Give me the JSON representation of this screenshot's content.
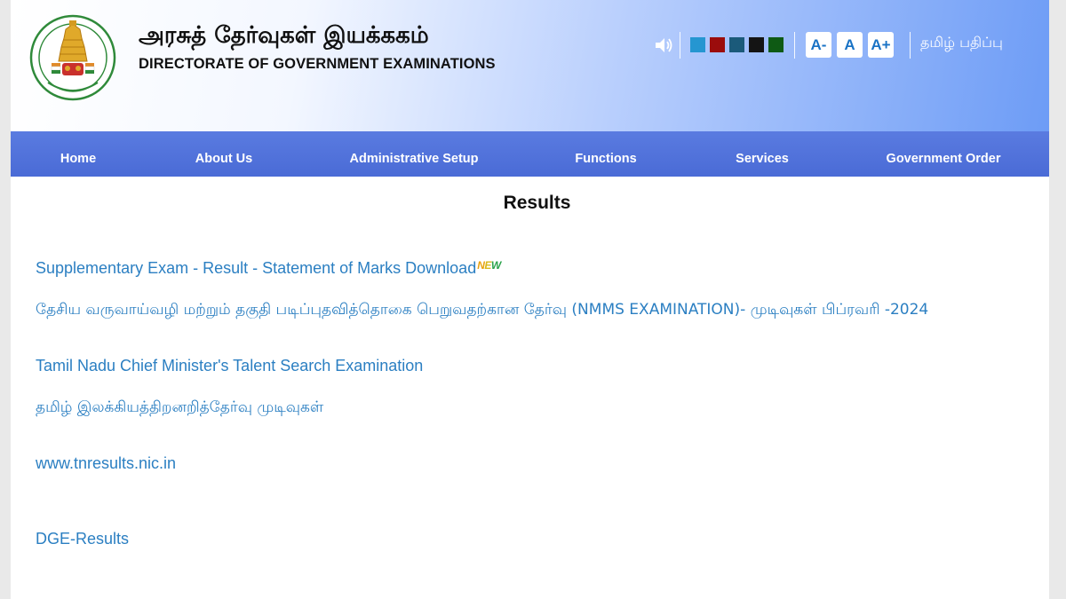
{
  "header": {
    "title_tamil": "அரசுத் தேர்வுகள் இயக்ககம்",
    "title_english": "DIRECTORATE OF GOVERNMENT EXAMINATIONS",
    "emblem_icon": "tamil-nadu-emblem-icon"
  },
  "toolbar": {
    "speaker_icon": "speaker-icon",
    "theme_colors": [
      "#2596d1",
      "#9b0c0c",
      "#1b5a7a",
      "#141414",
      "#0e5a14"
    ],
    "font_decrease_label": "A-",
    "font_reset_label": "A",
    "font_increase_label": "A+",
    "language_label": "தமிழ் பதிப்பு"
  },
  "nav": {
    "items": [
      {
        "label": "Home"
      },
      {
        "label": "About Us"
      },
      {
        "label": "Administrative Setup"
      },
      {
        "label": "Functions"
      },
      {
        "label": "Services"
      },
      {
        "label": "Government Order"
      }
    ]
  },
  "main": {
    "heading": "Results",
    "new_badge": "NEW",
    "links": [
      {
        "text": "Supplementary Exam - Result - Statement of Marks Download"
      },
      {
        "text": "தேசிய வருவாய்வழி மற்றும் தகுதி படிப்புதவித்தொகை பெறுவதற்கான தேர்வு (NMMS EXAMINATION)- முடிவுகள் பிப்ரவரி -2024"
      },
      {
        "text": "Tamil Nadu Chief Minister's Talent Search Examination"
      },
      {
        "text": "தமிழ் இலக்கியத்திறனறித்தேர்வு முடிவுகள்"
      },
      {
        "text": "www.tnresults.nic.in"
      },
      {
        "text": "DGE-Results"
      }
    ]
  },
  "colors": {
    "link": "#2b7fc2",
    "nav_bg": "#4f70da",
    "header_gradient_end": "#6d9cf6"
  }
}
